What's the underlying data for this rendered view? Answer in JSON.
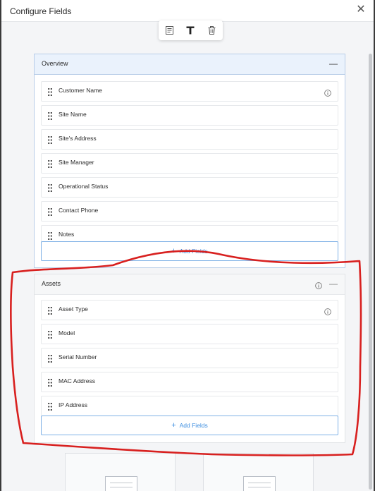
{
  "modal": {
    "title": "Configure Fields",
    "close_symbol": "✕"
  },
  "toolbar": {
    "buttons": [
      {
        "name": "form-icon"
      },
      {
        "name": "text-icon"
      },
      {
        "name": "trash-icon"
      }
    ]
  },
  "sections": {
    "overview": {
      "title": "Overview",
      "collapse_symbol": "—",
      "fields": [
        {
          "label": "Customer Name",
          "info": true
        },
        {
          "label": "Site Name",
          "info": false
        },
        {
          "label": "Site's Address",
          "info": false
        },
        {
          "label": "Site Manager",
          "info": false
        },
        {
          "label": "Operational Status",
          "info": false
        },
        {
          "label": "Contact Phone",
          "info": false
        },
        {
          "label": "Notes",
          "info": false
        }
      ],
      "add_label": "Add Fields"
    },
    "assets": {
      "title": "Assets",
      "collapse_symbol": "—",
      "fields": [
        {
          "label": "Asset Type",
          "info": true
        },
        {
          "label": "Model",
          "info": false
        },
        {
          "label": "Serial Number",
          "info": false
        },
        {
          "label": "MAC Address",
          "info": false
        },
        {
          "label": "IP Address",
          "info": false
        }
      ],
      "add_label": "Add Fields"
    }
  },
  "colors": {
    "accent": "#3d8ee0",
    "annotation": "#d8201f",
    "selected_header": "#eaf2fc"
  }
}
